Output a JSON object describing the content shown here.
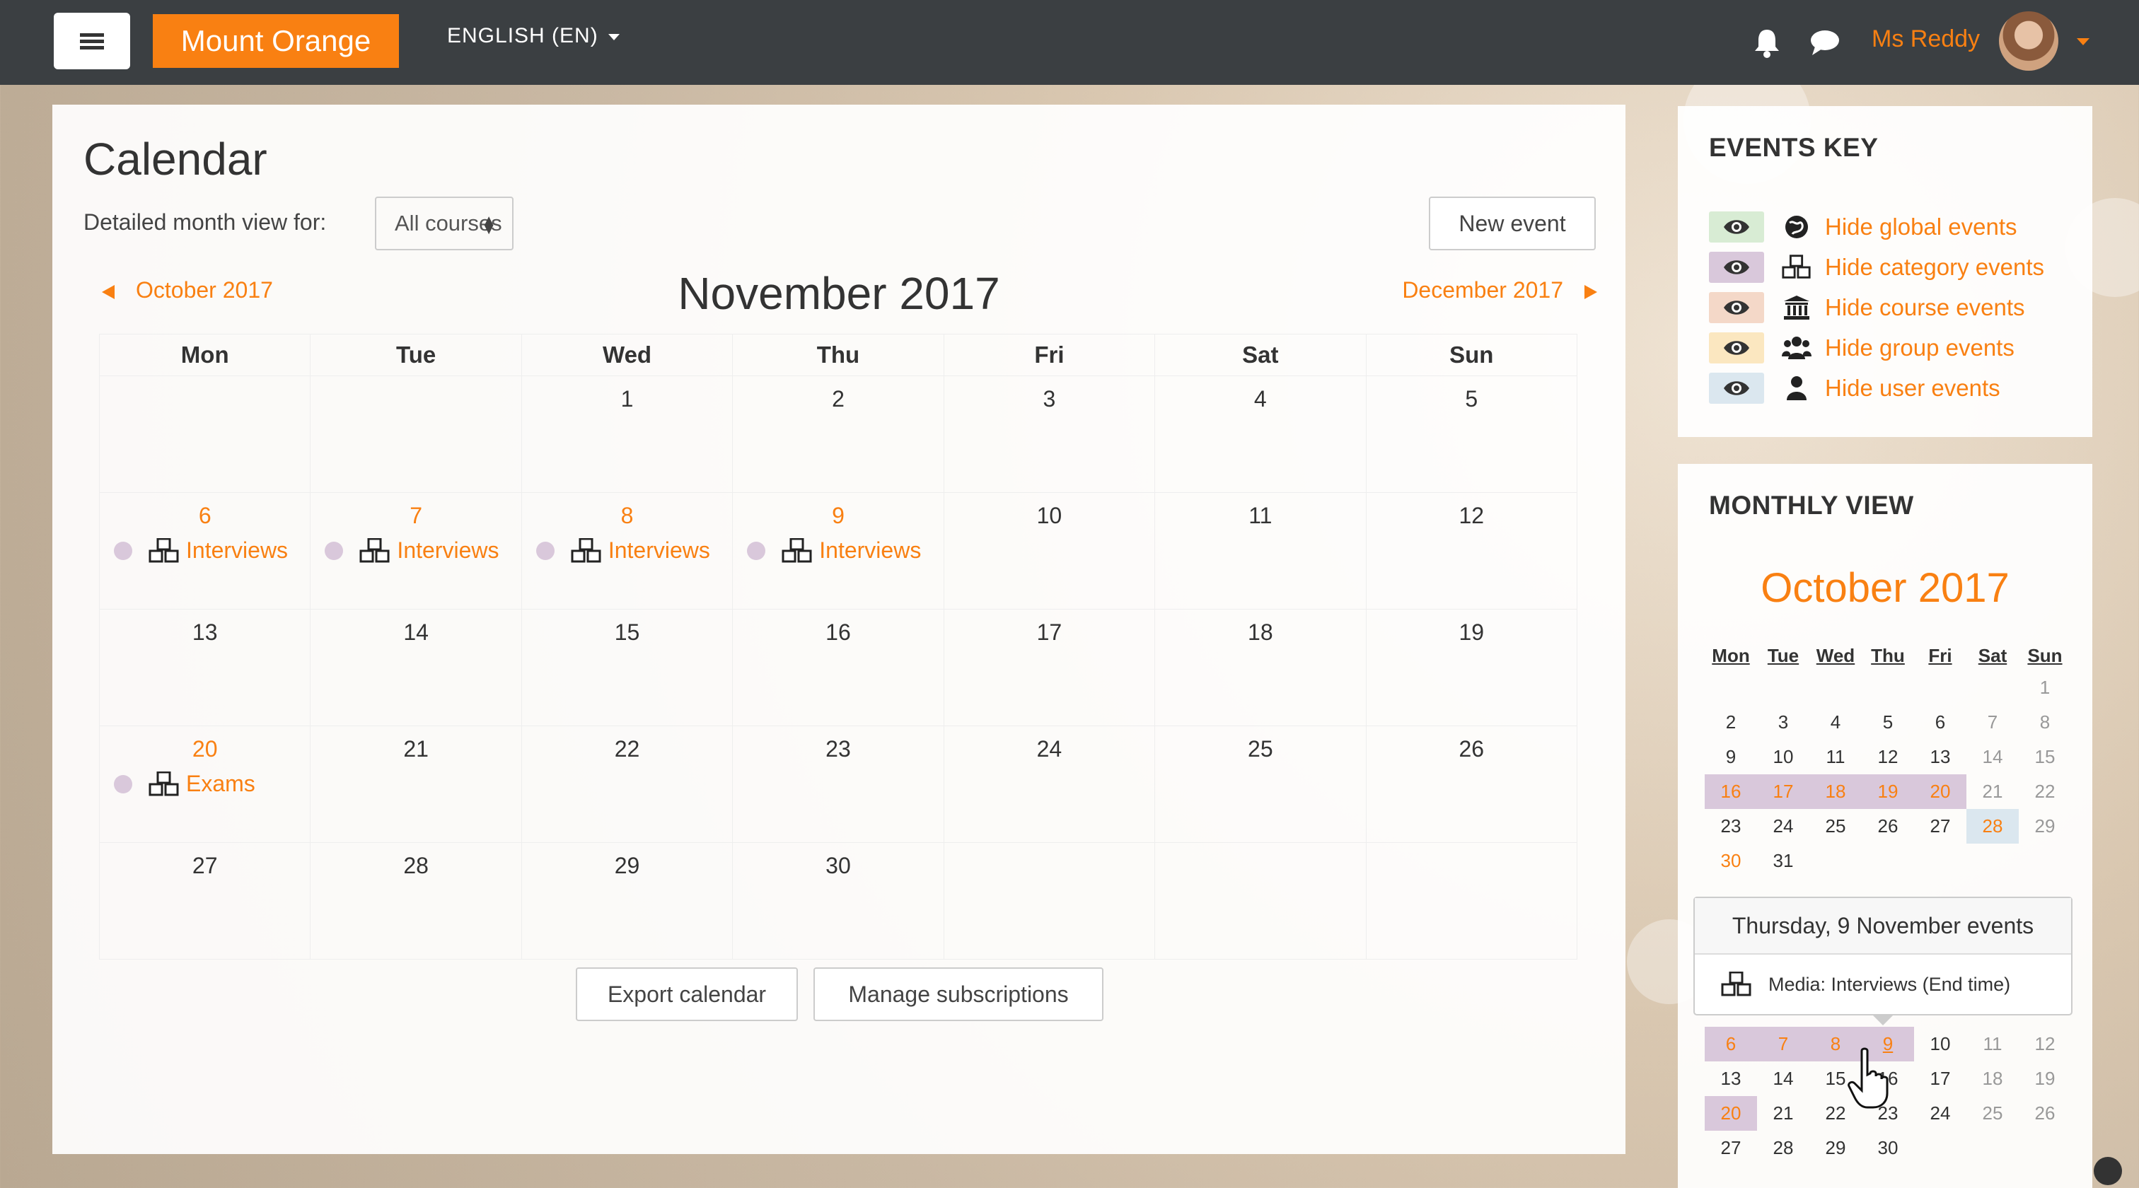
{
  "topbar": {
    "brand": "Mount Orange",
    "language": "ENGLISH (EN)",
    "username": "Ms Reddy"
  },
  "page": {
    "title": "Calendar",
    "filter_label": "Detailed month view for:",
    "course_select": "All courses",
    "new_event": "New event",
    "prev_month": "October 2017",
    "next_month": "December 2017",
    "month_title": "November 2017",
    "weekdays": [
      "Mon",
      "Tue",
      "Wed",
      "Thu",
      "Fri",
      "Sat",
      "Sun"
    ],
    "weeks": [
      [
        {
          "d": ""
        },
        {
          "d": ""
        },
        {
          "d": "1"
        },
        {
          "d": "2"
        },
        {
          "d": "3"
        },
        {
          "d": "4"
        },
        {
          "d": "5"
        }
      ],
      [
        {
          "d": "6",
          "ev": "Interviews"
        },
        {
          "d": "7",
          "ev": "Interviews"
        },
        {
          "d": "8",
          "ev": "Interviews"
        },
        {
          "d": "9",
          "ev": "Interviews"
        },
        {
          "d": "10"
        },
        {
          "d": "11"
        },
        {
          "d": "12"
        }
      ],
      [
        {
          "d": "13"
        },
        {
          "d": "14"
        },
        {
          "d": "15"
        },
        {
          "d": "16"
        },
        {
          "d": "17"
        },
        {
          "d": "18"
        },
        {
          "d": "19"
        }
      ],
      [
        {
          "d": "20",
          "ev": "Exams"
        },
        {
          "d": "21"
        },
        {
          "d": "22"
        },
        {
          "d": "23"
        },
        {
          "d": "24"
        },
        {
          "d": "25"
        },
        {
          "d": "26"
        }
      ],
      [
        {
          "d": "27"
        },
        {
          "d": "28"
        },
        {
          "d": "29"
        },
        {
          "d": "30"
        },
        {
          "d": ""
        },
        {
          "d": ""
        },
        {
          "d": ""
        }
      ]
    ],
    "export_button": "Export calendar",
    "manage_button": "Manage subscriptions"
  },
  "events_key": {
    "title": "EVENTS KEY",
    "items": [
      {
        "label": "Hide global events",
        "color": "#d8ecd4",
        "icon": "globe-icon"
      },
      {
        "label": "Hide category events",
        "color": "#d9c8db",
        "icon": "cubes-icon"
      },
      {
        "label": "Hide course events",
        "color": "#f4d8c8",
        "icon": "university-icon"
      },
      {
        "label": "Hide group events",
        "color": "#fbe7c0",
        "icon": "group-icon"
      },
      {
        "label": "Hide user events",
        "color": "#dbe7ef",
        "icon": "user-icon"
      }
    ]
  },
  "monthly_view": {
    "title": "MONTHLY VIEW",
    "oct_title": "October 2017",
    "weekdays": [
      "Mon",
      "Tue",
      "Wed",
      "Thu",
      "Fri",
      "Sat",
      "Sun"
    ],
    "oct_weeks": [
      [
        {
          "d": ""
        },
        {
          "d": ""
        },
        {
          "d": ""
        },
        {
          "d": ""
        },
        {
          "d": ""
        },
        {
          "d": ""
        },
        {
          "d": "1",
          "c": "we"
        }
      ],
      [
        {
          "d": "2"
        },
        {
          "d": "3"
        },
        {
          "d": "4"
        },
        {
          "d": "5"
        },
        {
          "d": "6"
        },
        {
          "d": "7",
          "c": "we"
        },
        {
          "d": "8",
          "c": "we"
        }
      ],
      [
        {
          "d": "9"
        },
        {
          "d": "10"
        },
        {
          "d": "11"
        },
        {
          "d": "12"
        },
        {
          "d": "13"
        },
        {
          "d": "14",
          "c": "we"
        },
        {
          "d": "15",
          "c": "we"
        }
      ],
      [
        {
          "d": "16",
          "c": "cat"
        },
        {
          "d": "17",
          "c": "cat"
        },
        {
          "d": "18",
          "c": "cat"
        },
        {
          "d": "19",
          "c": "cat"
        },
        {
          "d": "20",
          "c": "cat"
        },
        {
          "d": "21",
          "c": "we"
        },
        {
          "d": "22",
          "c": "we"
        }
      ],
      [
        {
          "d": "23"
        },
        {
          "d": "24"
        },
        {
          "d": "25"
        },
        {
          "d": "26"
        },
        {
          "d": "27"
        },
        {
          "d": "28",
          "c": "today"
        },
        {
          "d": "29",
          "c": "we"
        }
      ],
      [
        {
          "d": "30",
          "c": "ev2"
        },
        {
          "d": "31"
        },
        {
          "d": ""
        },
        {
          "d": ""
        },
        {
          "d": ""
        },
        {
          "d": ""
        },
        {
          "d": ""
        }
      ]
    ],
    "nov_weeks": [
      [
        {
          "d": "6",
          "c": "cat"
        },
        {
          "d": "7",
          "c": "cat"
        },
        {
          "d": "8",
          "c": "cat"
        },
        {
          "d": "9",
          "c": "cat"
        },
        {
          "d": "10"
        },
        {
          "d": "11",
          "c": "we"
        },
        {
          "d": "12",
          "c": "we"
        }
      ],
      [
        {
          "d": "13"
        },
        {
          "d": "14"
        },
        {
          "d": "15"
        },
        {
          "d": "16"
        },
        {
          "d": "17"
        },
        {
          "d": "18",
          "c": "we"
        },
        {
          "d": "19",
          "c": "we"
        }
      ],
      [
        {
          "d": "20",
          "c": "cat"
        },
        {
          "d": "21"
        },
        {
          "d": "22"
        },
        {
          "d": "23"
        },
        {
          "d": "24"
        },
        {
          "d": "25",
          "c": "we"
        },
        {
          "d": "26",
          "c": "we"
        }
      ],
      [
        {
          "d": "27"
        },
        {
          "d": "28"
        },
        {
          "d": "29"
        },
        {
          "d": "30"
        },
        {
          "d": ""
        },
        {
          "d": ""
        },
        {
          "d": ""
        }
      ]
    ],
    "popover": {
      "title": "Thursday, 9 November events",
      "event": "Media: Interviews (End time)"
    }
  }
}
